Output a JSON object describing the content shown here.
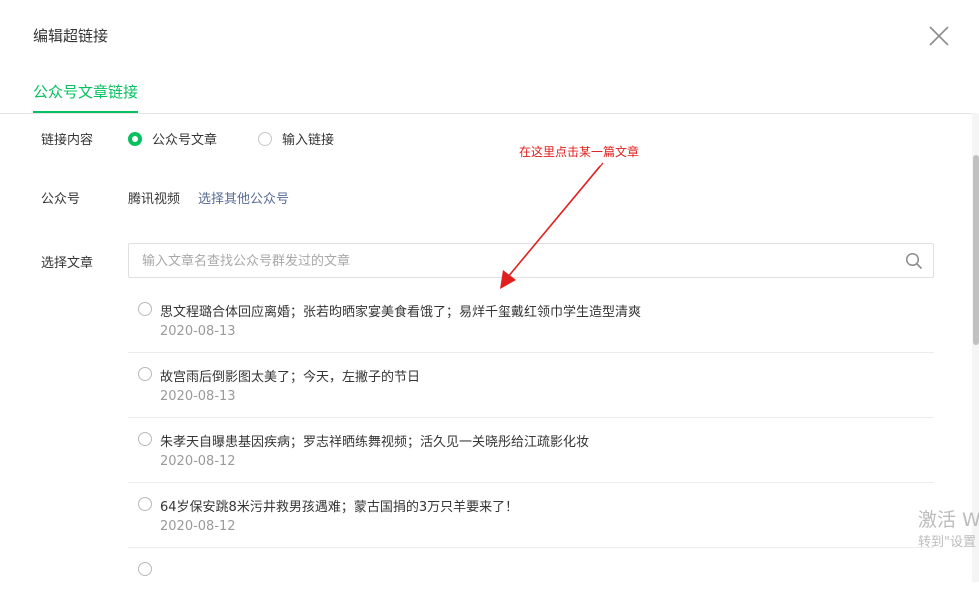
{
  "dialog": {
    "title": "编辑超链接",
    "tab_active": "公众号文章链接"
  },
  "link_content": {
    "label": "链接内容",
    "options": [
      {
        "label": "公众号文章",
        "checked": true
      },
      {
        "label": "输入链接",
        "checked": false
      }
    ]
  },
  "account": {
    "label": "公众号",
    "name": "腾讯视频",
    "change_link": "选择其他公众号"
  },
  "select_article": {
    "label": "选择文章",
    "search_placeholder": "输入文章名查找公众号群发过的文章"
  },
  "articles": [
    {
      "title": "思文程璐合体回应离婚；张若昀晒家宴美食看饿了；易烊千玺戴红领巾学生造型清爽",
      "date": "2020-08-13"
    },
    {
      "title": "故宫雨后倒影图太美了；今天，左撇子的节日",
      "date": "2020-08-13"
    },
    {
      "title": "朱孝天自曝患基因疾病；罗志祥晒练舞视频；活久见一关晓彤给江疏影化妆",
      "date": "2020-08-12"
    },
    {
      "title": "64岁保安跳8米污井救男孩遇难；蒙古国捐的3万只羊要来了！",
      "date": "2020-08-12"
    },
    {
      "title": "",
      "date": ""
    }
  ],
  "annotation": {
    "text": "在这里点击某一篇文章",
    "color": "#e0201e"
  },
  "watermark": {
    "line1": "激活 W",
    "line2": "转到\"设置"
  },
  "colors": {
    "accent": "#07c160",
    "link": "#576b95"
  }
}
